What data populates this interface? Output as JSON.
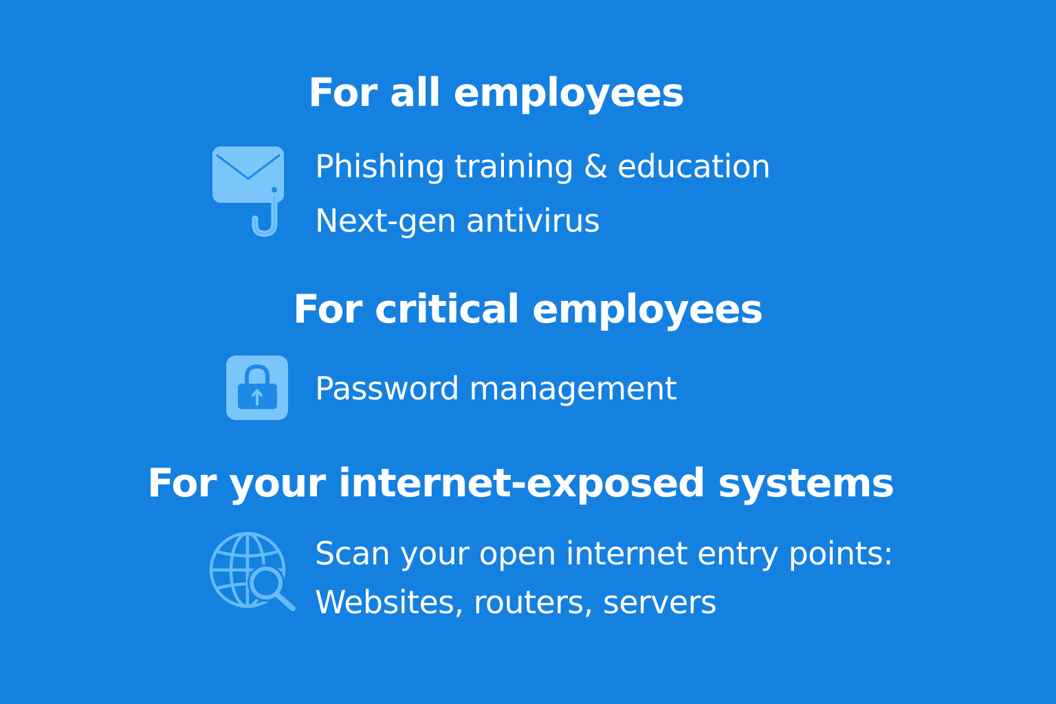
{
  "theme": {
    "background": "#1480e0",
    "text": "#ffffff",
    "icon_fill": "#7ac6fb",
    "icon_stroke": "#5fb4f2",
    "icon_detail": "#1f8ae6"
  },
  "sections": [
    {
      "heading": "For all employees",
      "icon": "phishing-envelope-hook-icon",
      "items": [
        "Phishing training & education",
        "Next-gen antivirus"
      ]
    },
    {
      "heading": "For critical employees",
      "icon": "padlock-icon",
      "items": [
        "Password management"
      ]
    },
    {
      "heading": "For your internet-exposed systems",
      "icon": "globe-search-icon",
      "items": [
        "Scan your open internet entry points:",
        "Websites, routers, servers"
      ]
    }
  ]
}
